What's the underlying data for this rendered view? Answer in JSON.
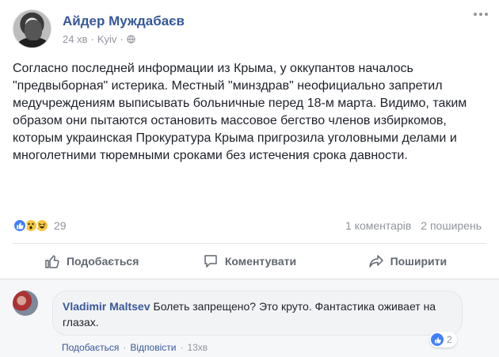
{
  "post": {
    "author": "Айдер Муждабаєв",
    "time": "24 хв",
    "location": "Kyiv",
    "text": "Согласно последней информации из Крыма, у оккупантов началось \"предвыборная\" истерика. Местный \"минздрав\" неофициально запретил медучреждениям выписывать больничные перед 18-м марта. Видимо, таким образом они пытаются остановить массовое бегство членов избиркомов, которым украинская Прокуратура Крыма пригрозила уголовными делами и многолетними тюремными сроками без истечения срока давности."
  },
  "reactions": {
    "types": [
      "like-icon",
      "wow-icon",
      "haha-icon"
    ],
    "count": "29",
    "comments": "1 коментарів",
    "shares": "2 поширень"
  },
  "actions": {
    "like": "Подобається",
    "comment": "Коментувати",
    "share": "Поширити"
  },
  "comment": {
    "author": "Vladimir Maltsev",
    "text": "Болеть запрещено? Это круто. Фантастика оживает на глазах.",
    "like_link": "Подобається",
    "reply_link": "Відповісти",
    "time": "13хв",
    "reaction_count": "2"
  },
  "colors": {
    "link": "#365899",
    "muted": "#90949c",
    "like_blue": "#4080ff",
    "action_gray": "#606770"
  }
}
